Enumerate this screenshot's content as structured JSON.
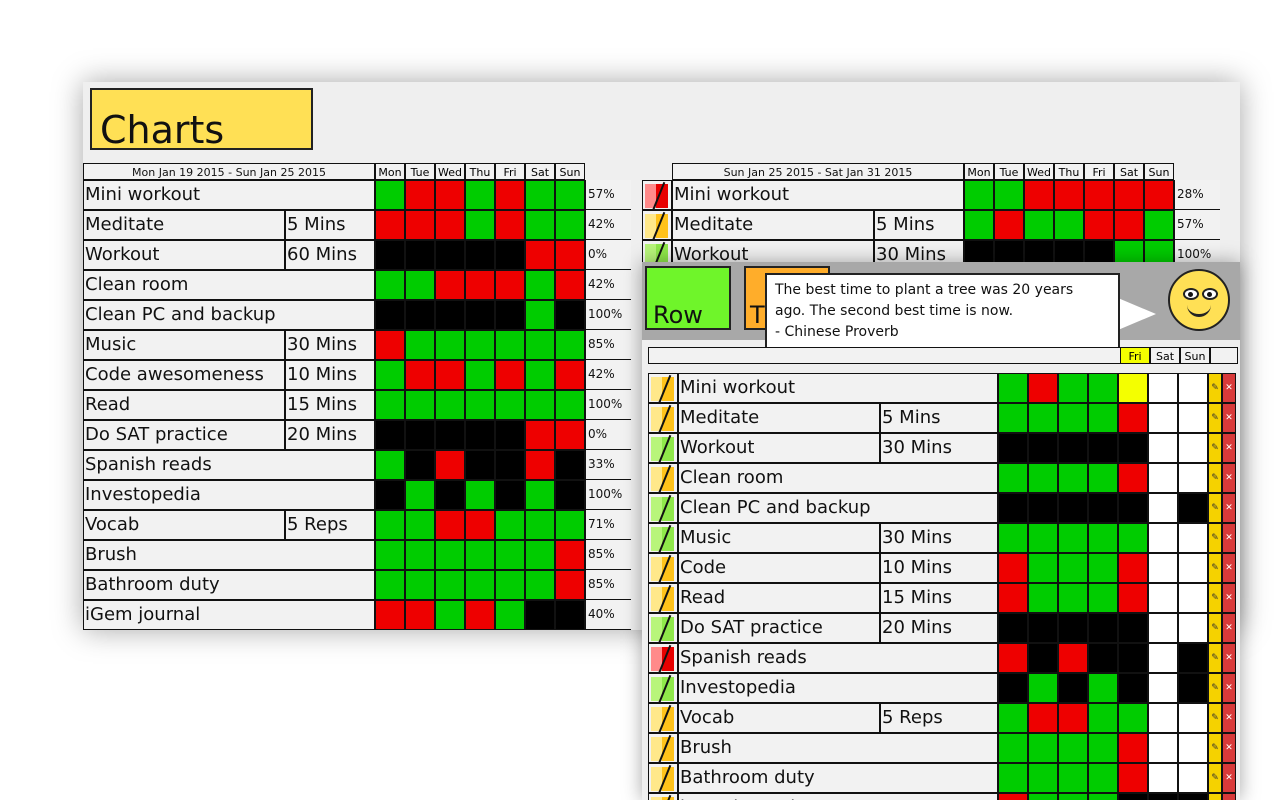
{
  "app": {
    "title": "Charts"
  },
  "week1": {
    "range": "Mon Jan 19 2015 - Sun Jan 25 2015",
    "days": [
      "Mon",
      "Tue",
      "Wed",
      "Thu",
      "Fri",
      "Sat",
      "Sun"
    ],
    "rows": [
      {
        "name": "Mini workout",
        "dur": "",
        "cells": "grrgrgg",
        "pct": "57%"
      },
      {
        "name": "Meditate",
        "dur": "5 Mins",
        "cells": "rrrgrgg",
        "pct": "42%"
      },
      {
        "name": "Workout",
        "dur": "60 Mins",
        "cells": "kkkkkrr",
        "pct": "0%"
      },
      {
        "name": "Clean room",
        "dur": "",
        "cells": "ggrrrgr",
        "pct": "42%"
      },
      {
        "name": "Clean PC and backup",
        "dur": "",
        "cells": "kkkkkgk",
        "pct": "100%"
      },
      {
        "name": "Music",
        "dur": "30 Mins",
        "cells": "rgggggg",
        "pct": "85%"
      },
      {
        "name": "Code awesomeness",
        "dur": "10 Mins",
        "cells": "grrgrgr",
        "pct": "42%"
      },
      {
        "name": "Read",
        "dur": "15 Mins",
        "cells": "ggggggg",
        "pct": "100%"
      },
      {
        "name": "Do SAT practice",
        "dur": "20 Mins",
        "cells": "kkkkkrr",
        "pct": "0%"
      },
      {
        "name": "Spanish reads",
        "dur": "",
        "cells": "gkrkkrk",
        "pct": "33%"
      },
      {
        "name": "Investopedia",
        "dur": "",
        "cells": "kgkgkgk",
        "pct": "100%"
      },
      {
        "name": "Vocab",
        "dur": "5 Reps",
        "cells": "ggrrggg",
        "pct": "71%"
      },
      {
        "name": "Brush",
        "dur": "",
        "cells": "ggggggr",
        "pct": "85%"
      },
      {
        "name": "Bathroom duty",
        "dur": "",
        "cells": "ggggggr",
        "pct": "85%"
      },
      {
        "name": "iGem journal",
        "dur": "",
        "cells": "rrgrgkk",
        "pct": "40%"
      }
    ]
  },
  "week2": {
    "range": "Sun Jan 25 2015 - Sat Jan 31 2015",
    "days": [
      "Mon",
      "Tue",
      "Wed",
      "Thu",
      "Fri",
      "Sat",
      "Sun"
    ],
    "rows": [
      {
        "name": "Mini workout",
        "dur": "",
        "cells": "ggrrrrr",
        "pct": "28%",
        "flag": "#ff8a8a"
      },
      {
        "name": "Meditate",
        "dur": "5 Mins",
        "cells": "grggrrg",
        "pct": "57%",
        "flag": "#ffe88a"
      },
      {
        "name": "Workout",
        "dur": "30 Mins",
        "cells": "kkkkkgg",
        "pct": "100%",
        "flag": "#b8f57a"
      }
    ]
  },
  "overlay": {
    "row_button": "Row",
    "t_button": "T",
    "quote_line1": "The best time to plant a tree was 20 years",
    "quote_line2": "ago. The second best time is now.",
    "quote_line3": "- Chinese Proverb",
    "days_visible": [
      "Fri",
      "Sat",
      "Sun"
    ],
    "rows": [
      {
        "name": "Mini workout",
        "dur": "",
        "cells": "grggyww",
        "flag": "#ffe88a"
      },
      {
        "name": "Meditate",
        "dur": "5 Mins",
        "cells": "ggggrww",
        "flag": "#ffe88a"
      },
      {
        "name": "Workout",
        "dur": "30 Mins",
        "cells": "kkkkkww",
        "flag": "#b8f57a"
      },
      {
        "name": "Clean room",
        "dur": "",
        "cells": "ggggrww",
        "flag": "#ffe88a"
      },
      {
        "name": "Clean PC and backup",
        "dur": "",
        "cells": "kkkkkwk",
        "flag": "#b8f57a"
      },
      {
        "name": "Music",
        "dur": "30 Mins",
        "cells": "gggggww",
        "flag": "#b8f57a"
      },
      {
        "name": "Code",
        "dur": "10 Mins",
        "cells": "rgggrww",
        "flag": "#ffe88a"
      },
      {
        "name": "Read",
        "dur": "15 Mins",
        "cells": "rgggrww",
        "flag": "#ffe88a"
      },
      {
        "name": "Do SAT practice",
        "dur": "20 Mins",
        "cells": "kkkkkww",
        "flag": "#b8f57a"
      },
      {
        "name": "Spanish reads",
        "dur": "",
        "cells": "rkrkkwk",
        "flag": "#ff8a8a"
      },
      {
        "name": "Investopedia",
        "dur": "",
        "cells": "kgkgkwk",
        "flag": "#b8f57a"
      },
      {
        "name": "Vocab",
        "dur": "5 Reps",
        "cells": "grrggww",
        "flag": "#ffe88a"
      },
      {
        "name": "Brush",
        "dur": "",
        "cells": "ggggrww",
        "flag": "#ffe88a"
      },
      {
        "name": "Bathroom duty",
        "dur": "",
        "cells": "ggggrww",
        "flag": "#ffe88a"
      },
      {
        "name": "iGem journal",
        "dur": "",
        "cells": "rgggkkk",
        "flag": "#ffe88a"
      }
    ]
  }
}
